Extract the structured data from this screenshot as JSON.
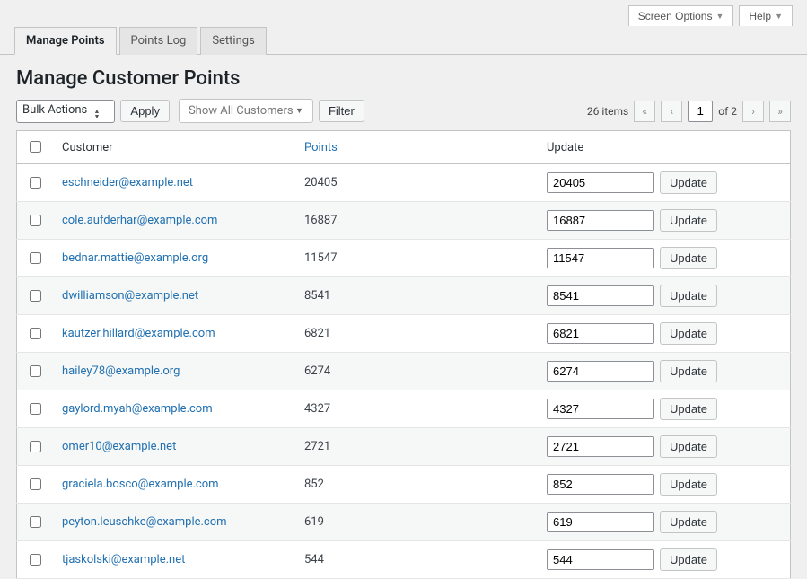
{
  "topbar": {
    "screen_options": "Screen Options",
    "help": "Help"
  },
  "tabs": [
    {
      "label": "Manage Points",
      "active": true
    },
    {
      "label": "Points Log",
      "active": false
    },
    {
      "label": "Settings",
      "active": false
    }
  ],
  "heading": "Manage Customer Points",
  "toolbar": {
    "bulk_actions": "Bulk Actions",
    "apply": "Apply",
    "filter_select": "Show All Customers",
    "filter": "Filter"
  },
  "pager": {
    "count_text": "26 items",
    "current": "1",
    "of_text": "of 2"
  },
  "columns": {
    "customer": "Customer",
    "points": "Points",
    "update": "Update"
  },
  "update_btn": "Update",
  "rows": [
    {
      "email": "eschneider@example.net",
      "points": "20405",
      "input": "20405"
    },
    {
      "email": "cole.aufderhar@example.com",
      "points": "16887",
      "input": "16887"
    },
    {
      "email": "bednar.mattie@example.org",
      "points": "11547",
      "input": "11547"
    },
    {
      "email": "dwilliamson@example.net",
      "points": "8541",
      "input": "8541"
    },
    {
      "email": "kautzer.hillard@example.com",
      "points": "6821",
      "input": "6821"
    },
    {
      "email": "hailey78@example.org",
      "points": "6274",
      "input": "6274"
    },
    {
      "email": "gaylord.myah@example.com",
      "points": "4327",
      "input": "4327"
    },
    {
      "email": "omer10@example.net",
      "points": "2721",
      "input": "2721"
    },
    {
      "email": "graciela.bosco@example.com",
      "points": "852",
      "input": "852"
    },
    {
      "email": "peyton.leuschke@example.com",
      "points": "619",
      "input": "619"
    },
    {
      "email": "tjaskolski@example.net",
      "points": "544",
      "input": "544"
    }
  ]
}
